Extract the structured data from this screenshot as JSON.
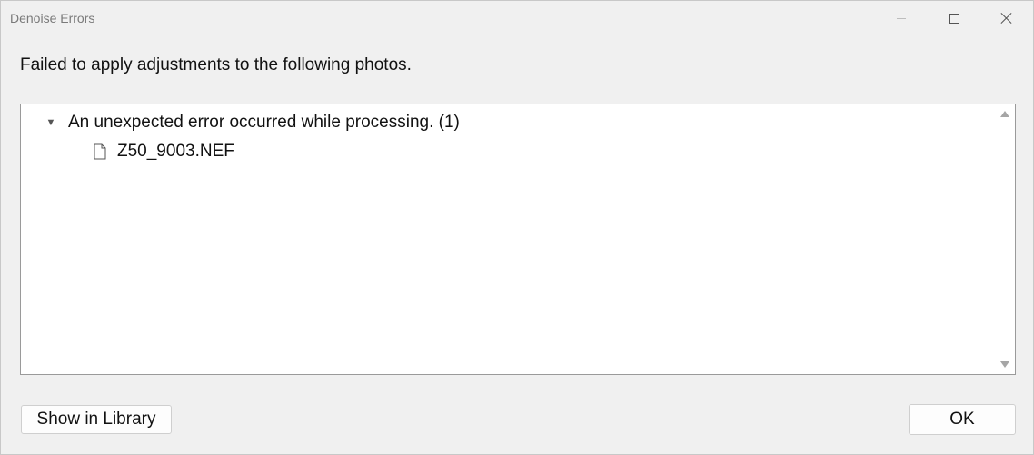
{
  "window": {
    "title": "Denoise Errors"
  },
  "dialog": {
    "message": "Failed to apply adjustments to the following photos."
  },
  "tree": {
    "groups": [
      {
        "label": "An unexpected error occurred while processing. (1)",
        "expanded": true,
        "items": [
          {
            "label": "Z50_9003.NEF",
            "icon": "file-icon"
          }
        ]
      }
    ]
  },
  "buttons": {
    "show_in_library": "Show in Library",
    "ok": "OK"
  },
  "colors": {
    "dialog_bg": "#f0f0f0",
    "list_bg": "#ffffff",
    "border": "#9a9a9a",
    "title_text": "#7a7a7a"
  }
}
